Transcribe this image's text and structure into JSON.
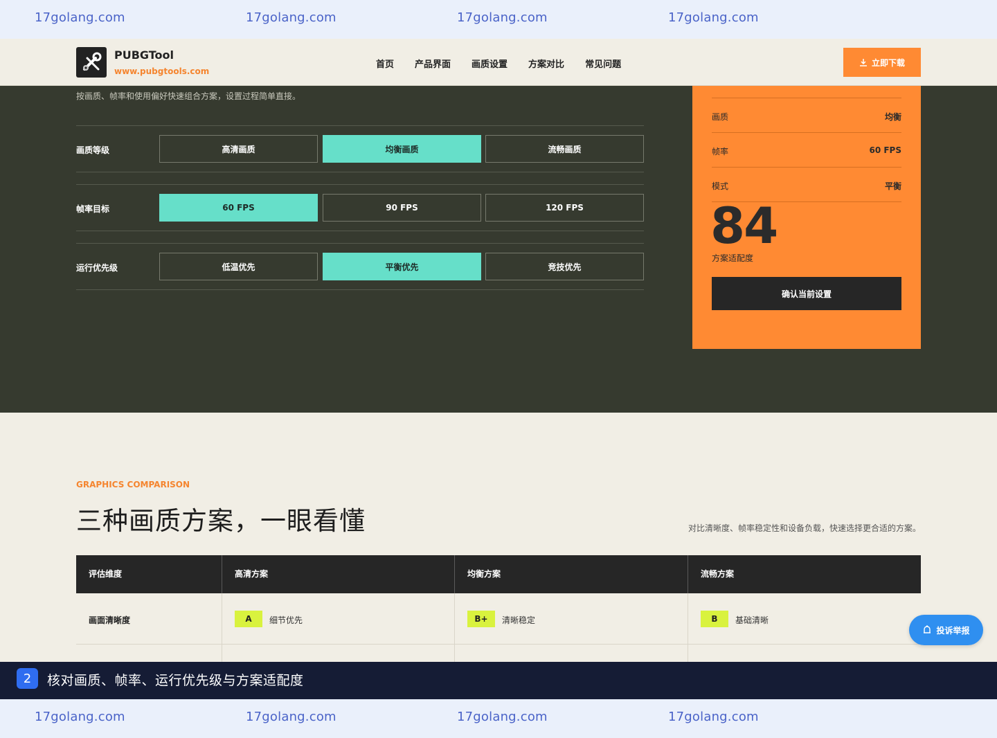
{
  "watermark": {
    "text": "17golang.com"
  },
  "header": {
    "brand_name": "PUBGTool",
    "brand_url": "www.pubgtools.com",
    "nav": [
      "首页",
      "产品界面",
      "画质设置",
      "方案对比",
      "常见问题"
    ],
    "download_label": "立即下载"
  },
  "config": {
    "intro": "按画质、帧率和使用偏好快速组合方案，设置过程简单直接。",
    "groups": [
      {
        "label": "画质等级",
        "options": [
          "高清画质",
          "均衡画质",
          "流畅画质"
        ],
        "selected": "均衡画质"
      },
      {
        "label": "帧率目标",
        "options": [
          "60 FPS",
          "90 FPS",
          "120 FPS"
        ],
        "selected": "60 FPS"
      },
      {
        "label": "运行优先级",
        "options": [
          "低温优先",
          "平衡优先",
          "竞技优先"
        ],
        "selected": "平衡优先"
      }
    ]
  },
  "summary": {
    "rows": [
      {
        "key": "画质",
        "value": "均衡"
      },
      {
        "key": "帧率",
        "value": "60 FPS"
      },
      {
        "key": "模式",
        "value": "平衡"
      }
    ],
    "score": "84",
    "score_label": "方案适配度",
    "confirm_label": "确认当前设置"
  },
  "comparison": {
    "eyebrow": "GRAPHICS COMPARISON",
    "title": "三种画质方案，一眼看懂",
    "subtitle": "对比清晰度、帧率稳定性和设备负载，快速选择更合适的方案。",
    "headers": [
      "评估维度",
      "高清方案",
      "均衡方案",
      "流畅方案"
    ],
    "rows": [
      {
        "label": "画面清晰度",
        "cells": [
          {
            "grade": "A",
            "text": "细节优先"
          },
          {
            "grade": "B+",
            "text": "清晰稳定"
          },
          {
            "grade": "B",
            "text": "基础清晰"
          }
        ]
      }
    ]
  },
  "report_label": "投诉举报",
  "caption": {
    "step": "2",
    "text": "核对画质、帧率、运行优先级与方案适配度"
  },
  "colors": {
    "accent": "#ff8a33",
    "teal": "#66dfc9",
    "dark": "#363a2f",
    "cream": "#f1eee5"
  }
}
